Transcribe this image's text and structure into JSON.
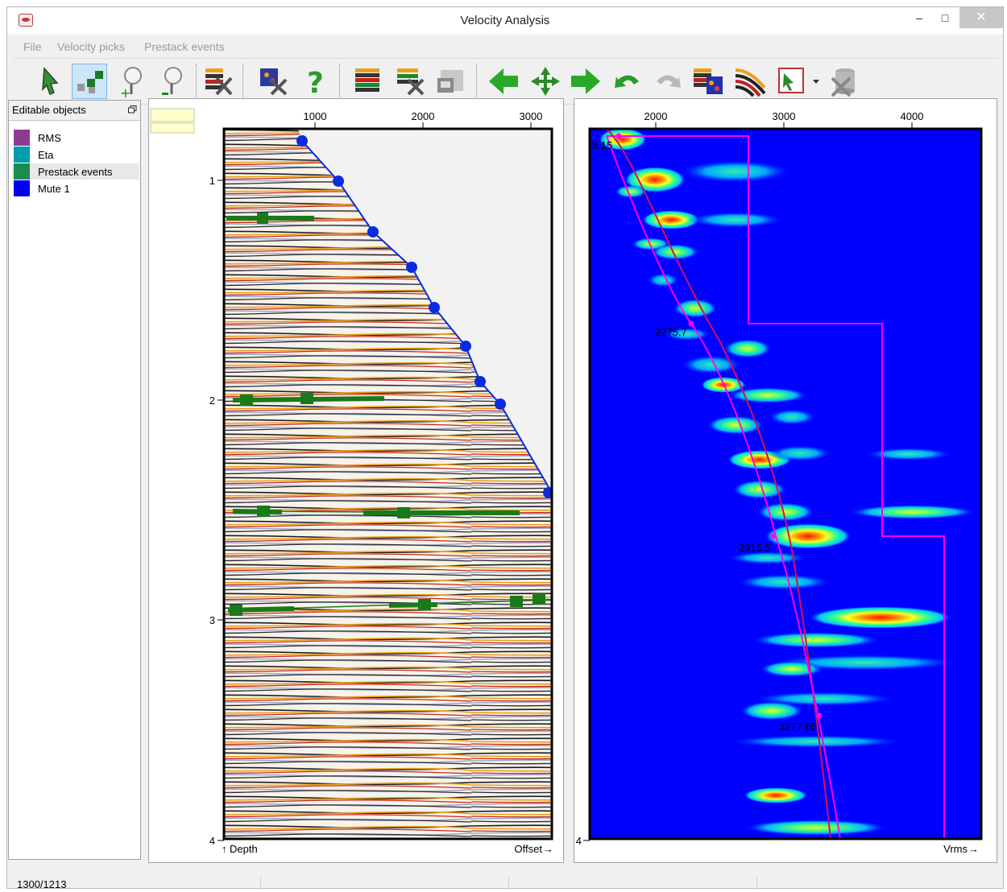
{
  "window": {
    "title": "Velocity Analysis"
  },
  "menu": {
    "items": [
      "File",
      "Velocity picks",
      "Prestack events"
    ]
  },
  "toolbar": {
    "buttons": [
      {
        "name": "select-arrow-icon"
      },
      {
        "name": "edit-points-icon"
      },
      {
        "name": "zoom-in-icon"
      },
      {
        "name": "zoom-out-icon"
      },
      {
        "name": "remove-events-icon"
      },
      {
        "name": "settings-tools-icon"
      },
      {
        "name": "help-icon"
      },
      {
        "name": "gather-display-icon"
      },
      {
        "name": "gather-tools-icon"
      },
      {
        "name": "gather-save-icon"
      },
      {
        "name": "arrow-left-icon"
      },
      {
        "name": "move-icon"
      },
      {
        "name": "arrow-right-icon"
      },
      {
        "name": "undo-icon"
      },
      {
        "name": "redo-icon"
      },
      {
        "name": "semblance-display-icon"
      },
      {
        "name": "wiggle-display-icon"
      },
      {
        "name": "pick-mode-icon"
      },
      {
        "name": "dropdown-arrow-icon"
      },
      {
        "name": "delete-icon"
      }
    ]
  },
  "sidebar": {
    "title": "Editable objects",
    "items": [
      {
        "label": "RMS",
        "color": "#8e3a8e"
      },
      {
        "label": "Eta",
        "color": "#009db0"
      },
      {
        "label": "Prestack events",
        "color": "#1a8c4e"
      },
      {
        "label": "Mute 1",
        "color": "#0000f0"
      }
    ]
  },
  "gather_panel": {
    "x_ticks": [
      "1000",
      "2000",
      "3000"
    ],
    "y_ticks": [
      "1",
      "2",
      "3",
      "4"
    ],
    "y_axis_label": "Depth",
    "x_axis_label": "Offset",
    "mute_color": "#0a2be0",
    "event_color": "#1a7a1a"
  },
  "semblance_panel": {
    "x_ticks": [
      "2000",
      "3000",
      "4000"
    ],
    "y_ticks": [
      "4"
    ],
    "x_axis_label": "Vrms",
    "pick_labels": [
      "8.15",
      "2275.7",
      "2915.5",
      "3277.65"
    ],
    "background_color": "#0000ff",
    "rms_curve_color": "#d01060",
    "interval_curve_color": "#ff00ff"
  },
  "status": {
    "text": "1300/1213"
  }
}
